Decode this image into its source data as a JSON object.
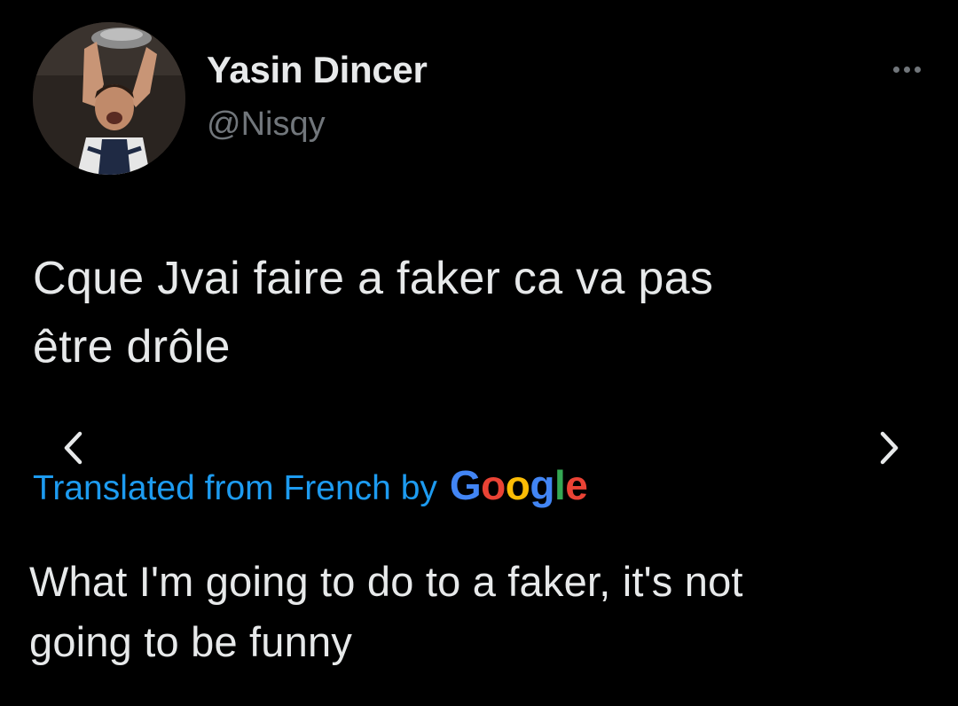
{
  "author": {
    "display_name": "Yasin Dincer",
    "handle": "@Nisqy"
  },
  "tweet": {
    "text_line1": "Cque Jvai faire a faker ca va pas",
    "text_line2": "être drôle"
  },
  "translation": {
    "label": "Translated from French by",
    "provider": {
      "letters": [
        "G",
        "o",
        "o",
        "g",
        "l",
        "e"
      ],
      "colors": [
        "#4285f4",
        "#ea4335",
        "#fbbc05",
        "#4285f4",
        "#34a853",
        "#ea4335"
      ]
    },
    "text_line1": "What I'm going to do to a faker, it's not",
    "text_line2": "going to be funny"
  },
  "icons": {
    "more": "more-dots-icon",
    "prev": "chevron-left-icon",
    "next": "chevron-right-icon"
  },
  "colors": {
    "background": "#000000",
    "primary_text": "#e7e9ea",
    "secondary_text": "#71767b",
    "link": "#1d9bf0"
  }
}
